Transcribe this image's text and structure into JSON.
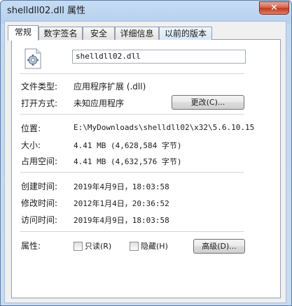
{
  "window": {
    "title": "shelldll02.dll 属性",
    "close_glyph": "✕"
  },
  "tabs": [
    {
      "label": "常规"
    },
    {
      "label": "数字签名"
    },
    {
      "label": "安全"
    },
    {
      "label": "详细信息"
    },
    {
      "label": "以前的版本"
    }
  ],
  "file": {
    "icon": "dll-file-icon",
    "name": "shelldll02.dll"
  },
  "type_row": {
    "label": "文件类型:",
    "value": "应用程序扩展 (.dll)"
  },
  "open_row": {
    "label": "打开方式:",
    "value": "未知应用程序",
    "change_button": "更改(C)..."
  },
  "location_row": {
    "label": "位置:",
    "value": "E:\\MyDownloads\\shelldll02\\x32\\5.6.10.15"
  },
  "size_row": {
    "label": "大小:",
    "value": "4.41 MB (4,628,584 字节)"
  },
  "disk_row": {
    "label": "占用空间:",
    "value": "4.41 MB (4,632,576 字节)"
  },
  "created_row": {
    "label": "创建时间:",
    "value": "2019年4月9日，18:03:58"
  },
  "modified_row": {
    "label": "修改时间:",
    "value": "2012年1月4日，20:36:52"
  },
  "accessed_row": {
    "label": "访问时间:",
    "value": "2019年4月9日，18:03:58"
  },
  "attributes": {
    "label": "属性:",
    "readonly_label": "只读(R)",
    "readonly_checked": false,
    "hidden_label": "隐藏(H)",
    "hidden_checked": false,
    "advanced_button": "高级(D)..."
  },
  "colors": {
    "title_bar": "#c3d9f1",
    "close_button": "#c2361c",
    "panel_bg": "#ffffff"
  }
}
